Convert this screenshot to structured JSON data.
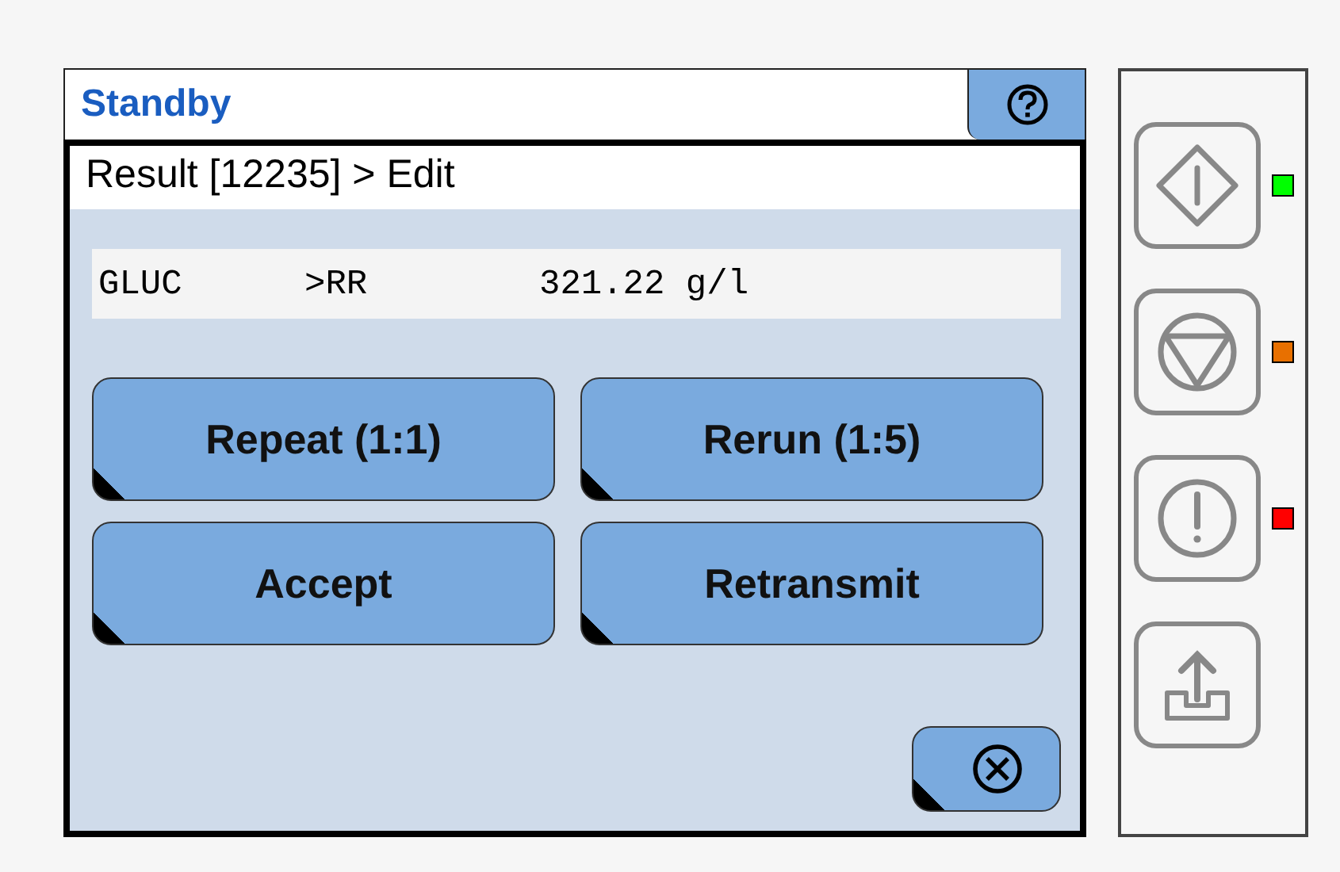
{
  "window": {
    "title": "Standby"
  },
  "breadcrumb": "Result [12235] > Edit",
  "result": {
    "test": "GLUC",
    "flag": ">RR",
    "value": "321.22 g/l"
  },
  "actions": [
    "Repeat (1:1)",
    "Rerun (1:5)",
    "Accept",
    "Retransmit"
  ],
  "side_buttons": [
    {
      "kind": "start",
      "color": "#00ff00"
    },
    {
      "kind": "stop",
      "color": "#e87000"
    },
    {
      "kind": "alarm",
      "color": "#ff0000"
    },
    {
      "kind": "upload"
    }
  ]
}
